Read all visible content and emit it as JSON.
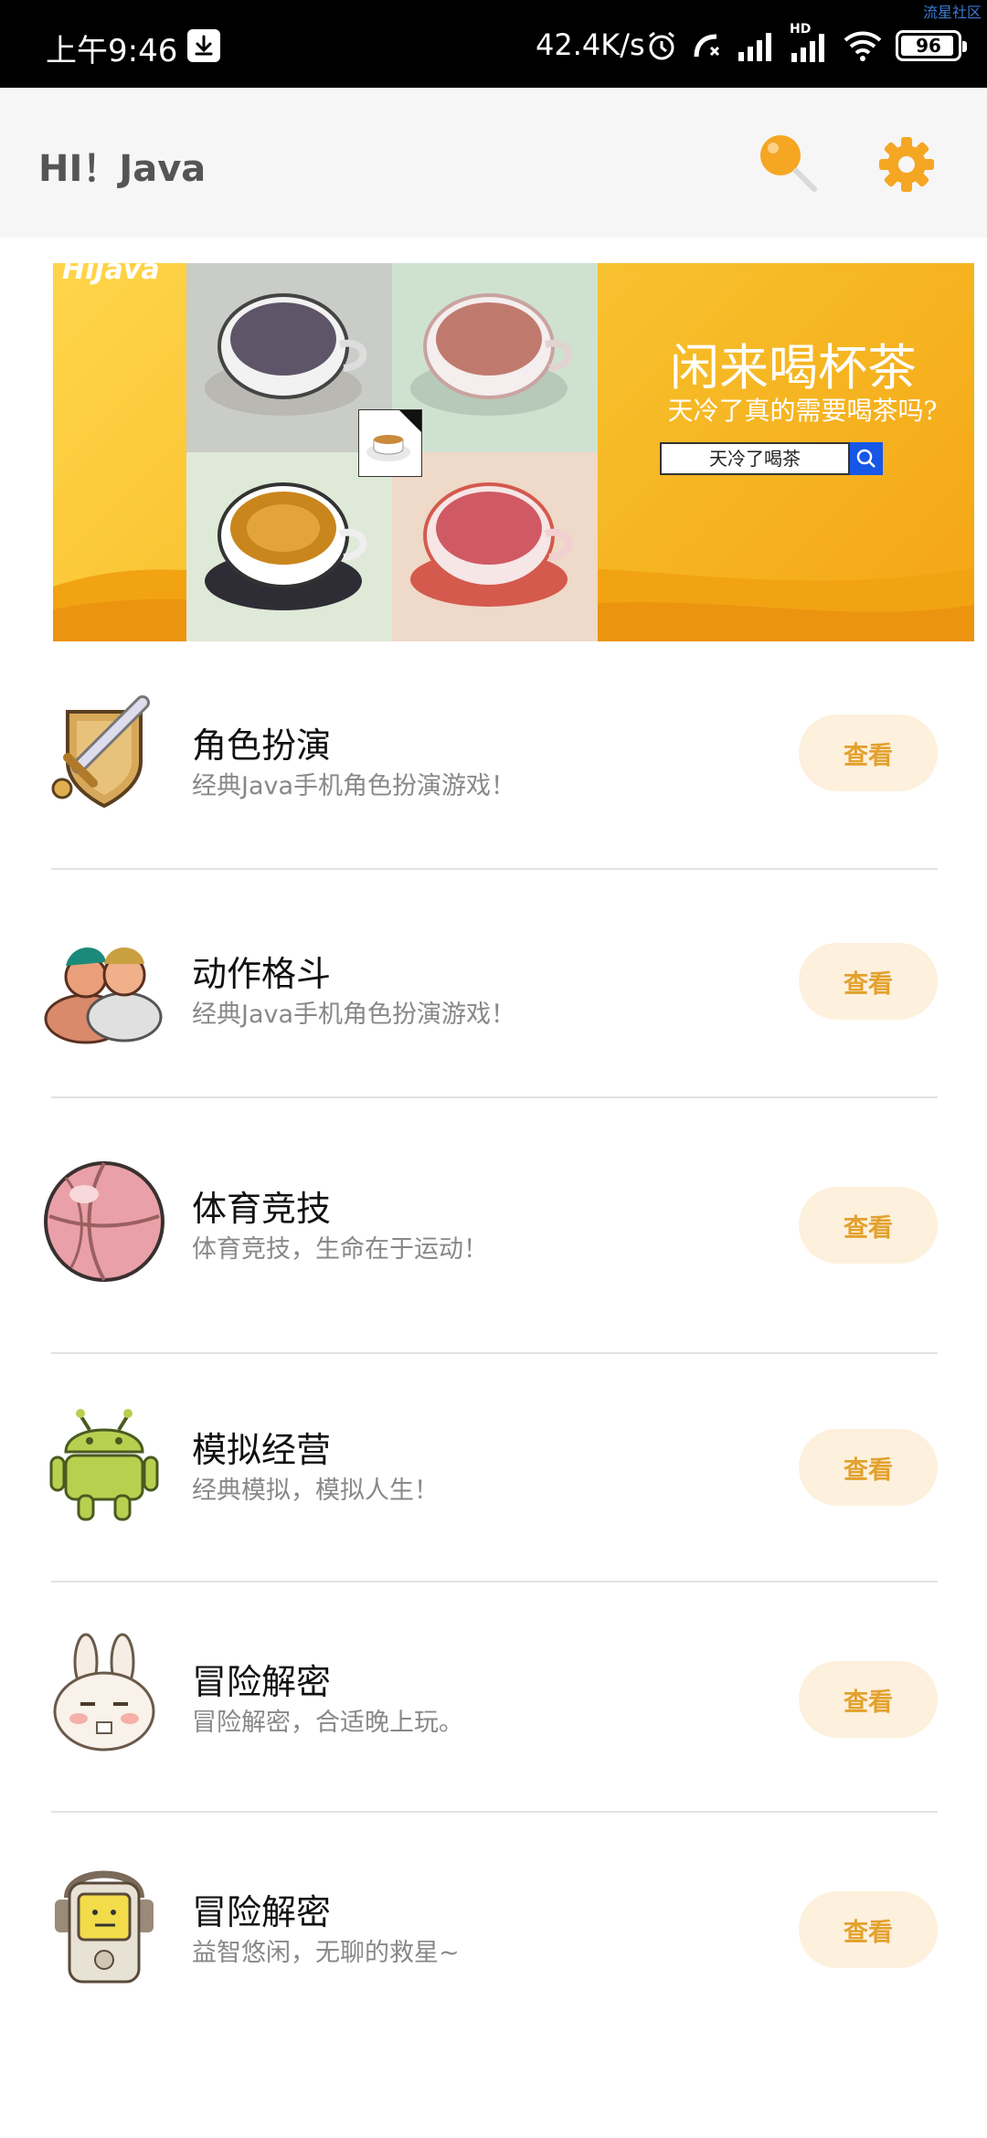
{
  "watermark": "流星社区",
  "status_bar": {
    "time": "上午9:46",
    "net_speed": "42.4K/s",
    "hd_label": "HD",
    "battery": "96",
    "battery_level": 0.96,
    "icons": [
      "download-icon",
      "alarm-icon",
      "call-forward-icon",
      "signal-icon",
      "hd-signal-icon",
      "wifi-icon",
      "battery-icon"
    ]
  },
  "app_bar": {
    "title": "HI！Java",
    "accent_color": "#f5a623",
    "icons": [
      "search-icon",
      "settings-icon"
    ]
  },
  "banner": {
    "watermark_text": "HiJava",
    "headline": "闲来喝杯茶",
    "subheadline": "天冷了真的需要喝茶吗?",
    "search_value": "天冷了喝茶"
  },
  "list": {
    "button_label": "查看",
    "items": [
      {
        "title": "角色扮演",
        "desc": "经典Java手机角色扮演游戏！",
        "icon": "sword-shield-icon"
      },
      {
        "title": "动作格斗",
        "desc": "经典Java手机角色扮演游戏！",
        "icon": "fighters-icon"
      },
      {
        "title": "体育竞技",
        "desc": "体育竞技，生命在于运动！",
        "icon": "ball-icon"
      },
      {
        "title": "模拟经营",
        "desc": "经典模拟，模拟人生！",
        "icon": "android-icon"
      },
      {
        "title": "冒险解密",
        "desc": "冒险解密，合适晚上玩。",
        "icon": "rabbit-icon"
      },
      {
        "title": "冒险解密",
        "desc": "益智悠闲，无聊的救星~",
        "icon": "music-player-icon"
      }
    ]
  }
}
